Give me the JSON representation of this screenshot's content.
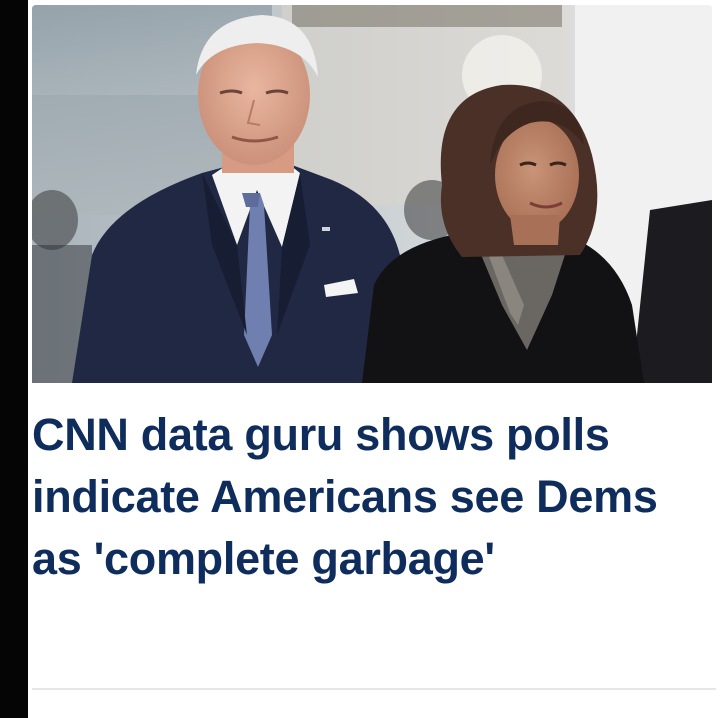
{
  "article": {
    "headline": "CNN data guru shows polls indicate Americans see Dems as 'complete garbage'"
  },
  "photo": {
    "icon": "news-photo"
  },
  "colors": {
    "headline": "#0f2d5c",
    "background": "#ffffff",
    "left_bar": "#050505"
  }
}
